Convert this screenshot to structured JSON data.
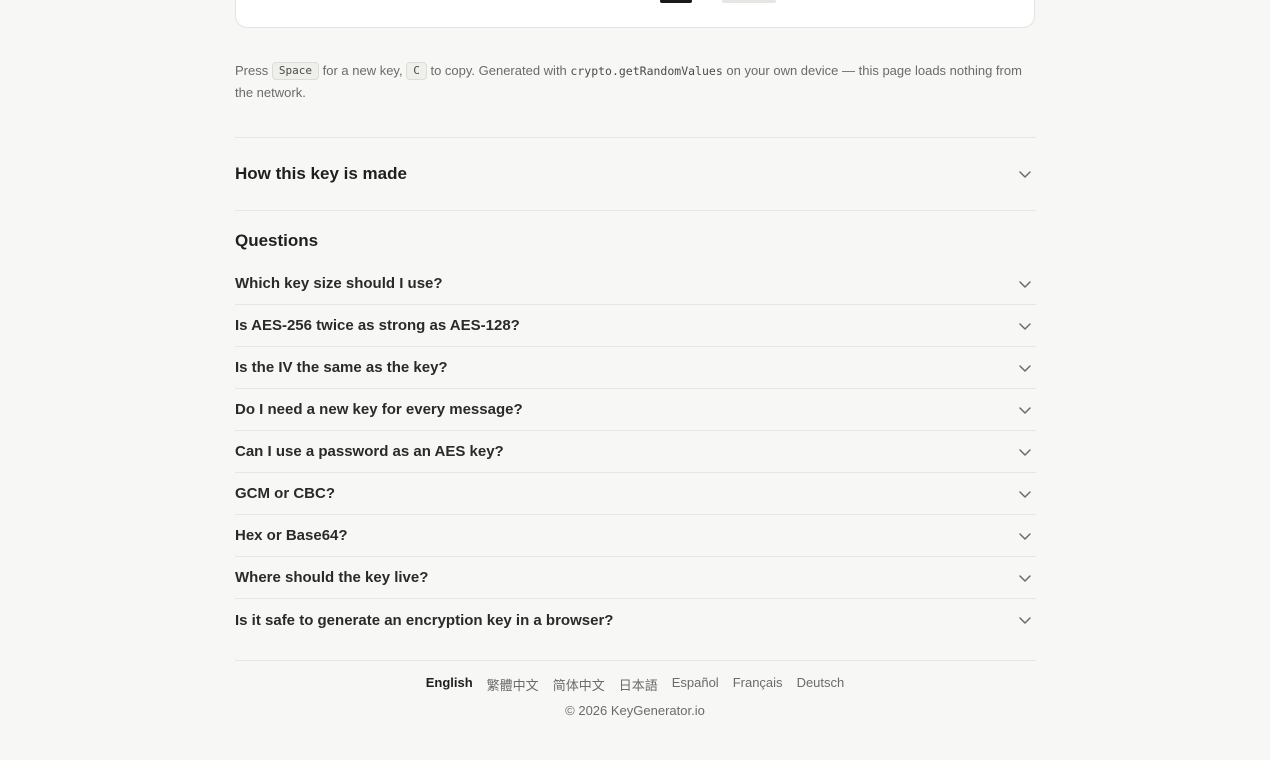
{
  "hint": {
    "press": "Press",
    "key_space": "Space",
    "for_new_key": "for a new key,",
    "key_c": "C",
    "to_copy": "to copy. Generated with",
    "api": "crypto.getRandomValues",
    "rest": "on your own device — this page loads nothing from the network."
  },
  "howto": {
    "title": "How this key is made",
    "icon": "chevron-down-icon"
  },
  "questions": {
    "heading": "Questions",
    "items": [
      {
        "q": "Which key size should I use?"
      },
      {
        "q": "Is AES-256 twice as strong as AES-128?"
      },
      {
        "q": "Is the IV the same as the key?"
      },
      {
        "q": "Do I need a new key for every message?"
      },
      {
        "q": "Can I use a password as an AES key?"
      },
      {
        "q": "GCM or CBC?"
      },
      {
        "q": "Hex or Base64?"
      },
      {
        "q": "Where should the key live?"
      },
      {
        "q": "Is it safe to generate an encryption key in a browser?"
      }
    ]
  },
  "footer": {
    "languages": [
      "English",
      "繁體中文",
      "简体中文",
      "日本語",
      "Español",
      "Français",
      "Deutsch"
    ],
    "active_language": "English",
    "copyright": "© 2026 KeyGenerator.io"
  }
}
